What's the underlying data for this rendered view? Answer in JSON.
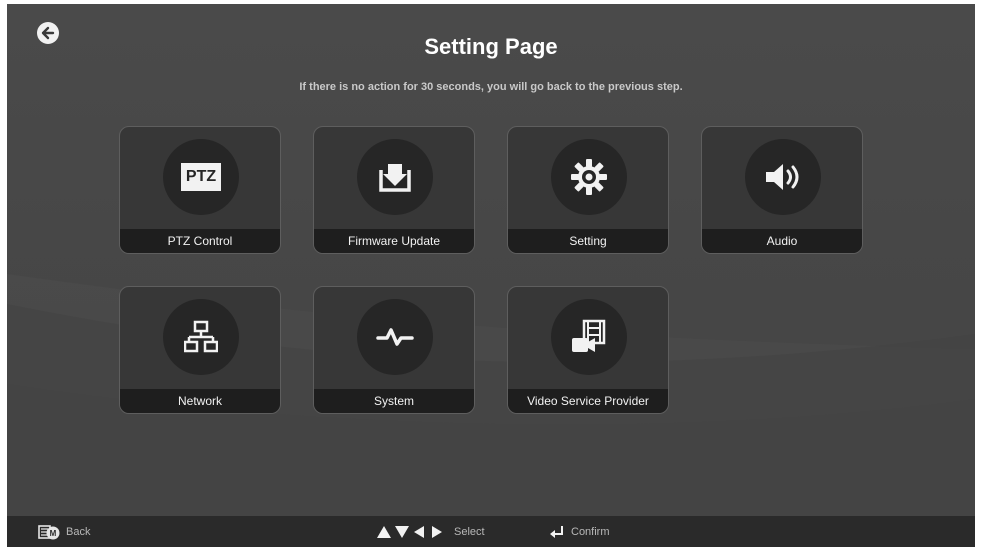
{
  "header": {
    "title": "Setting Page",
    "subtitle": "If there is no action for 30 seconds, you will go back to the previous step."
  },
  "tiles": [
    {
      "label": "PTZ Control",
      "icon": "ptz-icon",
      "icon_text": "PTZ"
    },
    {
      "label": "Firmware Update",
      "icon": "firmware-download-icon"
    },
    {
      "label": "Setting",
      "icon": "gear-icon"
    },
    {
      "label": "Audio",
      "icon": "speaker-icon"
    },
    {
      "label": "Network",
      "icon": "network-icon"
    },
    {
      "label": "System",
      "icon": "pulse-icon"
    },
    {
      "label": "Video Service Provider",
      "icon": "video-service-icon"
    }
  ],
  "footer": {
    "back_label": "Back",
    "back_key": "M",
    "select_label": "Select",
    "confirm_label": "Confirm"
  },
  "colors": {
    "background": "#474747",
    "tile": "#373737",
    "tile_label_bar": "#1e1e1e",
    "icon_circle": "#262626",
    "footer": "#2a2a2a",
    "text": "#ffffff"
  }
}
